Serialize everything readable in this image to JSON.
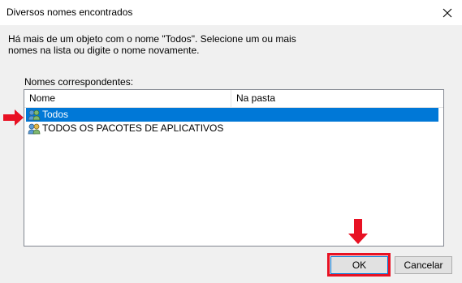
{
  "window": {
    "title": "Diversos nomes encontrados",
    "close_icon": "close-icon"
  },
  "message": "Há mais de um objeto com o nome \"Todos\". Selecione um ou mais nomes na lista ou digite o nome novamente.",
  "list": {
    "label": "Nomes correspondentes:",
    "columns": [
      "Nome",
      "Na pasta"
    ],
    "rows": [
      {
        "name": "Todos",
        "folder": "",
        "icon": "group-icon",
        "selected": true
      },
      {
        "name": "TODOS OS PACOTES DE APLICATIVOS",
        "folder": "",
        "icon": "group-icon",
        "selected": false
      }
    ]
  },
  "buttons": {
    "ok": "OK",
    "cancel": "Cancelar"
  },
  "colors": {
    "selection": "#0078d7",
    "annotation": "#e81123"
  }
}
